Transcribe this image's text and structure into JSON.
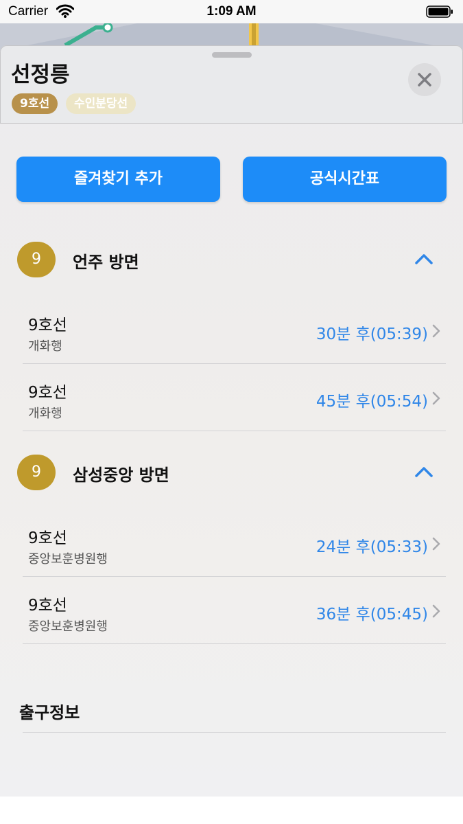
{
  "status_bar": {
    "carrier": "Carrier",
    "time": "1:09 AM"
  },
  "station": {
    "name": "선정릉",
    "lines": [
      {
        "label": "9호선",
        "color": "#b8914b"
      },
      {
        "label": "수인분당선",
        "color": "#ece5c6"
      }
    ]
  },
  "actions": {
    "favorite_label": "즐겨찾기 추가",
    "timetable_label": "공식시간표",
    "accent_color": "#1d8cf8"
  },
  "directions": [
    {
      "line_number": "9",
      "title": "언주 방면",
      "trains": [
        {
          "line": "9호선",
          "destination": "개화행",
          "arrival": "30분 후(05:39)"
        },
        {
          "line": "9호선",
          "destination": "개화행",
          "arrival": "45분 후(05:54)"
        }
      ]
    },
    {
      "line_number": "9",
      "title": "삼성중앙 방면",
      "trains": [
        {
          "line": "9호선",
          "destination": "중앙보훈병원행",
          "arrival": "24분 후(05:33)"
        },
        {
          "line": "9호선",
          "destination": "중앙보훈병원행",
          "arrival": "36분 후(05:45)"
        }
      ]
    }
  ],
  "exit_info": {
    "title": "출구정보"
  },
  "icons": {
    "close": "close-icon",
    "collapse": "chevron-up-icon",
    "disclosure": "chevron-right-icon",
    "wifi": "wifi-icon",
    "battery": "battery-icon"
  }
}
